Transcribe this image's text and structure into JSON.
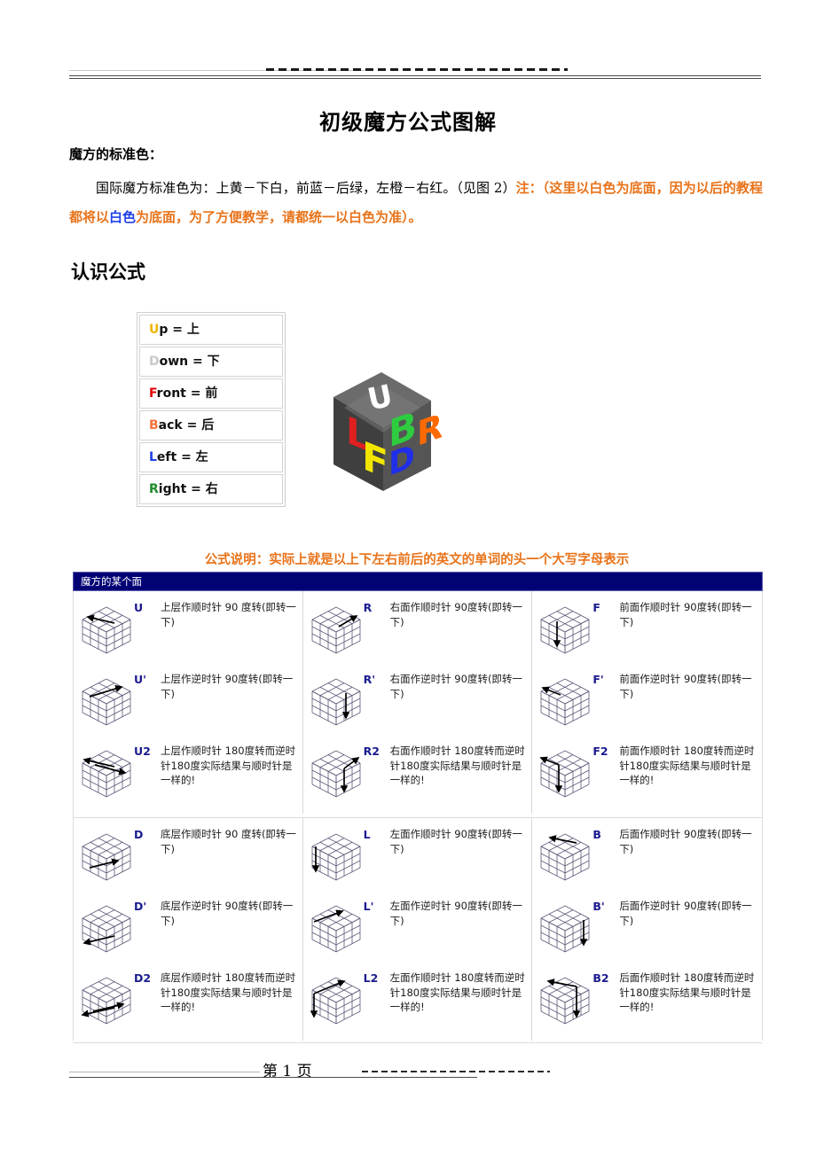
{
  "document": {
    "title": "初级魔方公式图解",
    "page_footer": "第 1 页"
  },
  "standard_color": {
    "label": "魔方的标准色：",
    "body_plain": "国际魔方标准色为：上黄－下白，前蓝－后绿，左橙－右红。（见图 2）",
    "note_part1": "注：（这里以白色为底面，因为以后的教程都将以",
    "note_highlight": "白色",
    "note_part2": "为底面，为了方便教学，请都统一以白色为准）。",
    "colors": {
      "orange": "#E8731A",
      "blue": "#1F3FE8"
    }
  },
  "learn_formula": {
    "heading": "认识公式",
    "legend": [
      {
        "initial": "U",
        "rest": "p = 上",
        "color": "#F0B400"
      },
      {
        "initial": "D",
        "rest": "own = 下",
        "color": "#C9C9C9"
      },
      {
        "initial": "F",
        "rest": "ront = 前",
        "color": "#E00000"
      },
      {
        "initial": "B",
        "rest": "ack = 后",
        "color": "#F4743B"
      },
      {
        "initial": "L",
        "rest": "eft = 左",
        "color": "#1F3FE8"
      },
      {
        "initial": "R",
        "rest": "ight = 右",
        "color": "#1E8B2A"
      }
    ],
    "cube_image": {
      "name": "rubiks-cube-face-labels",
      "body_color": "#4a4a4a",
      "labels": [
        {
          "text": "U",
          "color": "#ffffff"
        },
        {
          "text": "L",
          "color": "#e02020"
        },
        {
          "text": "F",
          "color": "#f2e600"
        },
        {
          "text": "B",
          "color": "#2ecc3f"
        },
        {
          "text": "R",
          "color": "#ff6a00"
        },
        {
          "text": "D",
          "color": "#1f2ee8"
        }
      ]
    }
  },
  "formula_note": "公式说明：实际上就是以上下左右前后的英文的单词的头一个大写字母表示",
  "move_table": {
    "header": "魔方的某个面",
    "header_bg": "#020275",
    "code_color": "#1b1b8f",
    "top_half": [
      {
        "column": "U",
        "cells": [
          {
            "code": "U",
            "desc": "上层作顺时针 90 度转(即转一下)",
            "arrow": "top-ccw"
          },
          {
            "code": "U'",
            "desc": "上层作逆时针 90度转(即转一下)",
            "arrow": "top-cw"
          },
          {
            "code": "U2",
            "desc": "上层作顺时针 180度转而逆时针180度实际结果与顺时针是一样的!",
            "arrow": "top-double"
          }
        ]
      },
      {
        "column": "R",
        "cells": [
          {
            "code": "R",
            "desc": "右面作顺时针 90度转(即转一下)",
            "arrow": "right-up"
          },
          {
            "code": "R'",
            "desc": "右面作逆时针 90度转(即转一下)",
            "arrow": "right-down"
          },
          {
            "code": "R2",
            "desc": "右面作顺时针 180度转而逆时针180度实际结果与顺时针是一样的!",
            "arrow": "right-double"
          }
        ]
      },
      {
        "column": "F",
        "cells": [
          {
            "code": "F",
            "desc": "前面作顺时针 90度转(即转一下)",
            "arrow": "front-down"
          },
          {
            "code": "F'",
            "desc": "前面作逆时针 90度转(即转一下)",
            "arrow": "front-left"
          },
          {
            "code": "F2",
            "desc": "前面作顺时针 180度转而逆时针180度实际结果与顺时针是一样的!",
            "arrow": "front-double"
          }
        ]
      }
    ],
    "bottom_half": [
      {
        "column": "D",
        "cells": [
          {
            "code": "D",
            "desc": "底层作顺时针 90 度转(即转一下)",
            "arrow": "bottom-right"
          },
          {
            "code": "D'",
            "desc": "底层作逆时针 90度转(即转一下)",
            "arrow": "bottom-left"
          },
          {
            "code": "D2",
            "desc": "底层作顺时针 180度转而逆时针180度实际结果与顺时针是一样的!",
            "arrow": "bottom-double"
          }
        ]
      },
      {
        "column": "L",
        "cells": [
          {
            "code": "L",
            "desc": "左面作顺时针 90度转(即转一下)",
            "arrow": "left-down"
          },
          {
            "code": "L'",
            "desc": "左面作逆时针 90度转(即转一下)",
            "arrow": "left-up"
          },
          {
            "code": "L2",
            "desc": "左面作顺时针 180度转而逆时针180度实际结果与顺时针是一样的!",
            "arrow": "left-double"
          }
        ]
      },
      {
        "column": "B",
        "cells": [
          {
            "code": "B",
            "desc": "后面作顺时针 90度转(即转一下)",
            "arrow": "back-left"
          },
          {
            "code": "B'",
            "desc": "后面作逆时针 90度转(即转一下)",
            "arrow": "back-down"
          },
          {
            "code": "B2",
            "desc": "后面作顺时针 180度转而逆时针180度实际结果与顺时针是一样的!",
            "arrow": "back-double"
          }
        ]
      }
    ]
  }
}
